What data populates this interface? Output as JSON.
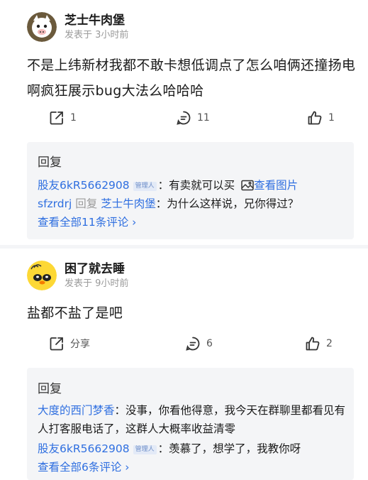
{
  "posts": [
    {
      "username": "芝士牛肉堡",
      "time": "发表于 3小时前",
      "content": "不是上纬新材我都不敢卡想低调点了怎么咱俩还撞扬电啊疯狂展示bug大法么哈哈哈",
      "share_label": "1",
      "comment_count": "11",
      "like_count": "1",
      "reply_title": "回复",
      "replies": [
        {
          "user": "股友6kR5662908",
          "badge": "管理人",
          "text": "：有卖就可以买",
          "image_link": "查看图片"
        },
        {
          "user": "sfzrdrj",
          "reply_word": "回复",
          "target": "芝士牛肉堡",
          "text": "：为什么这样说，兄你得过？"
        }
      ],
      "view_all": "查看全部11条评论 ›"
    },
    {
      "username": "困了就去睡",
      "time": "发表于 9小时前",
      "content": "盐都不盐了是吧",
      "share_label": "分享",
      "comment_count": "6",
      "like_count": "2",
      "reply_title": "回复",
      "replies": [
        {
          "user": "大度的西门梦香",
          "text": "：没事，你看他得意，我今天在群聊里都看见有人打客服电话了，这群人大概率收益清零"
        },
        {
          "user": "股友6kR5662908",
          "badge": "管理人",
          "text": "：羡慕了，想学了，我教你呀"
        }
      ],
      "view_all": "查看全部6条评论 ›"
    }
  ],
  "colors": {
    "link": "#2f6fe0",
    "muted": "#9a9a9a",
    "panel": "#f4f5f7"
  },
  "icons": [
    "share-icon",
    "comment-icon",
    "like-icon",
    "image-icon"
  ]
}
